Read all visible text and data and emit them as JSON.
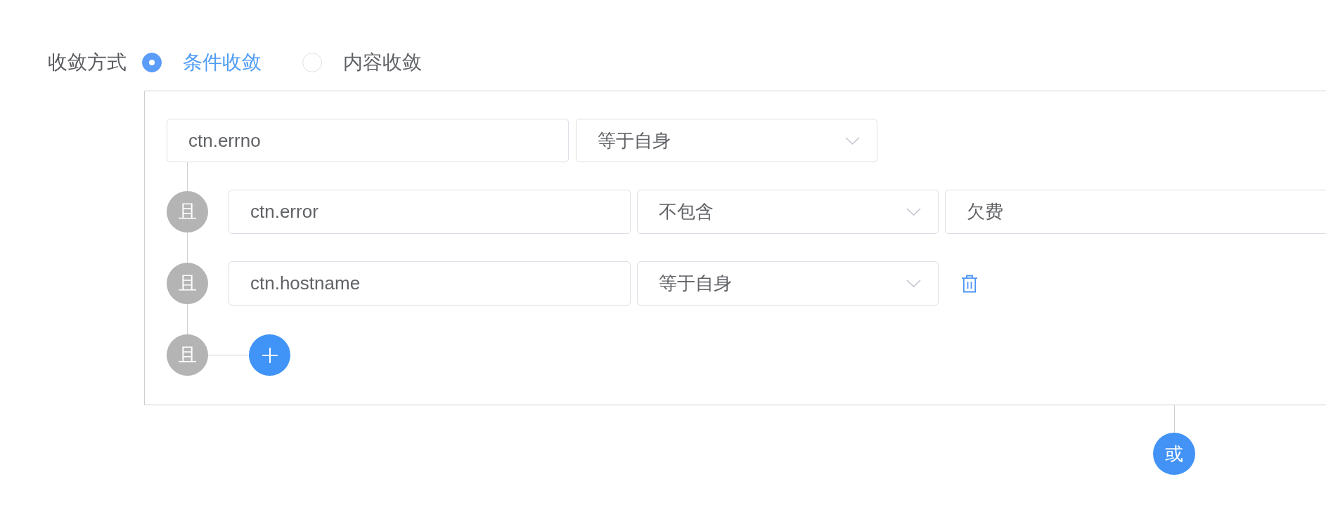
{
  "convergence_mode": {
    "label": "收敛方式",
    "options": [
      {
        "label": "条件收敛",
        "selected": true
      },
      {
        "label": "内容收敛",
        "selected": false
      }
    ]
  },
  "condition_group": {
    "root": {
      "field": "ctn.errno",
      "operator": "等于自身"
    },
    "conditions": [
      {
        "connector": "且",
        "field": "ctn.error",
        "operator": "不包含",
        "value": "欠费",
        "deletable": false
      },
      {
        "connector": "且",
        "field": "ctn.hostname",
        "operator": "等于自身",
        "deletable": true
      }
    ],
    "add_row": {
      "connector": "且"
    }
  },
  "group_connector": {
    "label": "或"
  }
}
